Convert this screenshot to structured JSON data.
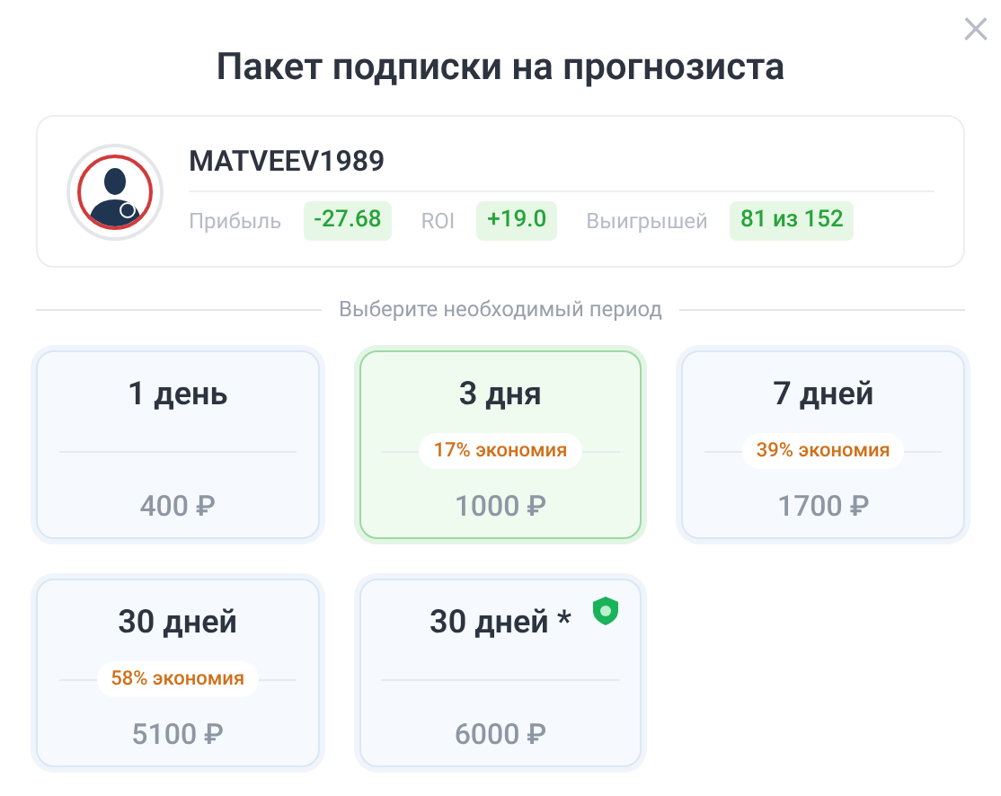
{
  "title": "Пакет подписки на прогнозиста",
  "close": "×",
  "profile": {
    "name": "MATVEEV1989",
    "stats": [
      {
        "label": "Прибыль",
        "value": "-27.68"
      },
      {
        "label": "ROI",
        "value": "+19.0"
      },
      {
        "label": "Выигрышей",
        "value": "81 из 152"
      }
    ]
  },
  "period_prompt": "Выберите необходимый период",
  "plans": [
    {
      "period": "1 день",
      "price": "400 ₽",
      "selected": false,
      "protected": false
    },
    {
      "period": "3 дня",
      "savings": "17% экономия",
      "price": "1000 ₽",
      "selected": true,
      "protected": false
    },
    {
      "period": "7 дней",
      "savings": "39% экономия",
      "price": "1700 ₽",
      "selected": false,
      "protected": false
    },
    {
      "period": "30 дней",
      "savings": "58% экономия",
      "price": "5100 ₽",
      "selected": false,
      "protected": false
    },
    {
      "period": "30 дней *",
      "price": "6000 ₽",
      "selected": false,
      "protected": true
    }
  ]
}
